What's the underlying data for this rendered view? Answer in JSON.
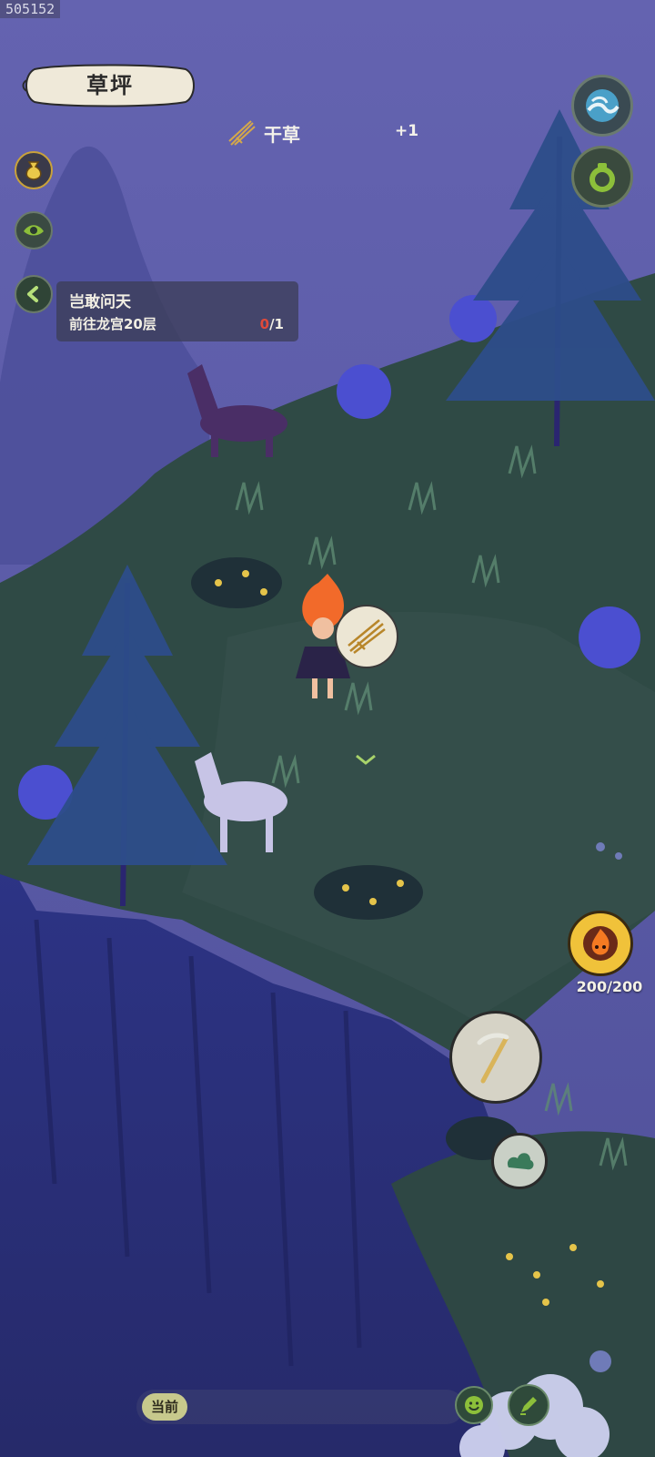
{
  "session_id": "505152",
  "location": {
    "name": "草坪"
  },
  "pickup": {
    "item_name": "干草",
    "count": "+1"
  },
  "quest": {
    "title": "岂敢问天",
    "description": "前往龙宫20层",
    "progress_current": "0",
    "progress_total": "/1"
  },
  "stamina": {
    "text": "200/200"
  },
  "chat": {
    "channel_label": "当前"
  },
  "icons": {
    "top_right_1": "wave-icon",
    "top_right_2": "pot-icon",
    "left_1": "money-bag-icon",
    "left_2": "eye-icon",
    "left_3": "chevron-left-icon",
    "gather": "hay-bundle-icon",
    "tool": "scythe-icon",
    "cloud_skill": "cloud-swirl-icon",
    "stamina": "fire-spirit-icon",
    "emoji": "smile-icon",
    "edit": "pen-icon"
  },
  "colors": {
    "sky": "#5b5aa3",
    "grass": "#2f4a45",
    "cliff": "#2b2f7a",
    "accent_gold": "#f0c23a",
    "progress_red": "#e04a3a"
  }
}
